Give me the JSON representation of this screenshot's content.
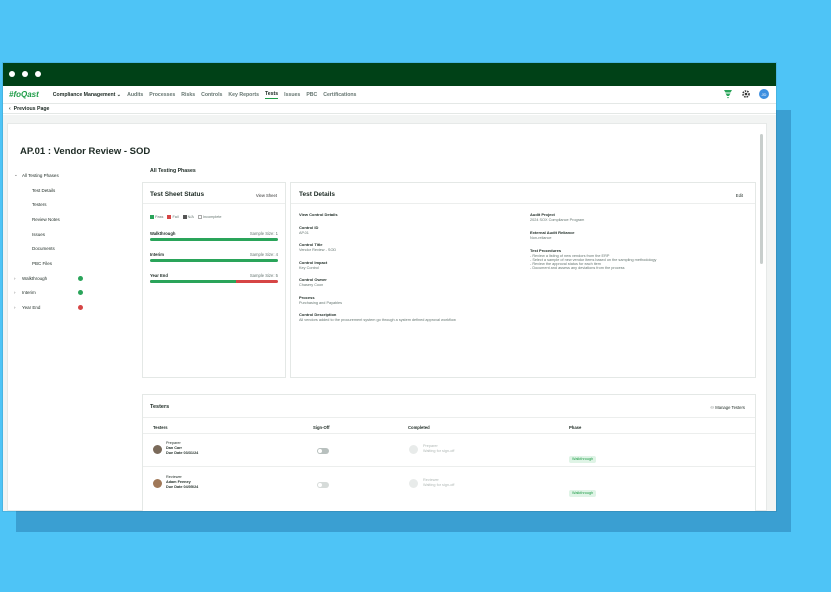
{
  "app": {
    "logo": "#foQast",
    "nav": [
      "Compliance Management ⌄",
      "Audits",
      "Processes",
      "Risks",
      "Controls",
      "Key Reports",
      "Tests",
      "Issues",
      "PBC",
      "Certifications"
    ],
    "active_tab": "Tests",
    "avatar": "JD",
    "back": "Previous Page"
  },
  "page": {
    "title": "AP.01 : Vendor Review - SOD",
    "section_title": "All Testing Phases"
  },
  "sidebar": {
    "root": "All Testing Phases",
    "children": [
      "Test Details",
      "Testers",
      "Review Notes",
      "Issues",
      "Documents",
      "PBC Files"
    ],
    "phases": [
      {
        "label": "Walkthrough",
        "status": "pass",
        "color": "#2aa45a"
      },
      {
        "label": "Interim",
        "status": "pass",
        "color": "#2aa45a"
      },
      {
        "label": "Year End",
        "status": "fail",
        "color": "#d64545"
      }
    ]
  },
  "sheet": {
    "title": "Test Sheet Status",
    "view": "View Sheet",
    "legend": [
      "Pass",
      "Fail",
      "N/A",
      "Incomplete"
    ],
    "rows": [
      {
        "label": "Walkthrough",
        "size": "Sample Size: 1",
        "pass": 1.0
      },
      {
        "label": "Interim",
        "size": "Sample Size: 4",
        "pass": 1.0
      },
      {
        "label": "Year End",
        "size": "Sample Size: 5",
        "pass": 0.67
      }
    ]
  },
  "details": {
    "title": "Test Details",
    "edit": "Edit",
    "left": [
      {
        "k": "View Control Details",
        "v": ""
      },
      {
        "k": "Control ID",
        "v": "AP.01"
      },
      {
        "k": "Control Title",
        "v": "Vendor Review - SOD"
      },
      {
        "k": "Control Impact",
        "v": "Key Control"
      },
      {
        "k": "Control Owner",
        "v": "Chasery Coon"
      },
      {
        "k": "Process",
        "v": "Purchasing and Payables"
      },
      {
        "k": "Control Description",
        "v": "All vendors added to the procurement system go through a system defined approval workflow"
      }
    ],
    "right": [
      {
        "k": "Audit Project",
        "v": "2024 SOX Compliance Program"
      },
      {
        "k": "External Audit Reliance",
        "v": "Non-reliance"
      }
    ],
    "procedures_title": "Test Procedures",
    "procedures": [
      "- Review a listing of new vendors from the ERP",
      "- Select a sample of new vendor items based on the sampling methodology",
      "- Review the approval status for each item",
      "- Document and assess any deviations from the process"
    ]
  },
  "testers": {
    "title": "Testers",
    "manage": "Manage Testers",
    "headers": [
      "Testers",
      "Sign-Off",
      "Completed",
      "Phase"
    ],
    "rows": [
      {
        "role": "Preparer",
        "name": "Dan Carr",
        "due": "Due Date 03/31/24",
        "completed_role": "Preparer",
        "completed_text": "Waiting for sign-off",
        "phase": "Walkthrough"
      },
      {
        "role": "Reviewer",
        "name": "Adam Feeney",
        "due": "Due Date 04/05/24",
        "completed_role": "Reviewer",
        "completed_text": "Waiting for sign-off",
        "phase": "Walkthrough"
      }
    ]
  },
  "colors": {
    "brand": "#1d9c46",
    "titlebar": "#004117",
    "fail": "#d64545",
    "background": "#4ec4f6"
  }
}
